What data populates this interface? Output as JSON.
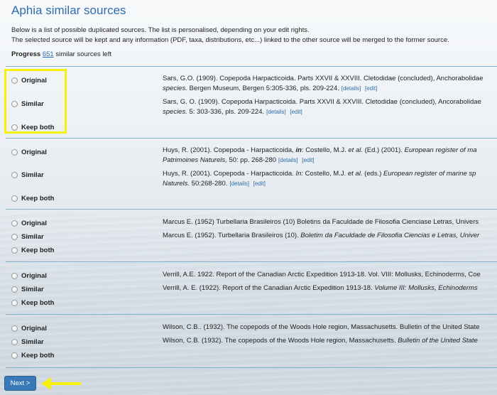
{
  "title": "Aphia similar sources",
  "intro": {
    "line1": "Below is a list of possible duplicated sources. The list is personalised, depending on your edit rights.",
    "line2": "The selected source will be kept and any information (PDF, taxa, distributions, etc...) linked to the other source will be merged to the former source."
  },
  "progress": {
    "label": "Progress",
    "count": "651",
    "suffix": "similar sources left"
  },
  "options": {
    "original": "Original",
    "similar": "Similar",
    "keep_both": "Keep both"
  },
  "links": {
    "details": "[details]",
    "edit": "[edit]"
  },
  "groups": [
    {
      "original": {
        "l1_plain": "Sars, G.O. (1909). Copepoda Harpacticoida. Parts XXVII & XXVIII. Cletodidae (concluded), Anchorabolidae",
        "l2_italic": "species.",
        "l2_plain": " Bergen Museum, Bergen 5:305-336, pls. 209-224."
      },
      "similar": {
        "l1_plain": "Sars, G. O. (1909). Copepoda Harpacticoida. Parts XXVII & XXVIII. Cletodidae (concluded), Ancorabolidae",
        "l2_italic": "species.",
        "l2_plain": " 5: 303-336, pls. 209-224."
      }
    },
    {
      "original": {
        "l1_a": "Huys, R. (2001). Copepoda - Harpacticoida, ",
        "l1_b": "in",
        "l1_c": ": Costello, M.J. ",
        "l1_d": "et al.",
        "l1_e": " (Ed.) (2001). ",
        "l1_f": "European register of ma",
        "l2_italic": "Patrimoines Naturels,",
        "l2_plain": " 50: pp. 268-280"
      },
      "similar": {
        "l1_a": "Huys, R. (2001). Copepoda - Harpacticoida. ",
        "l1_b": "In: ",
        "l1_c": "Costello, M.J. ",
        "l1_d": "et al.",
        "l1_e": " (eds.) ",
        "l1_f": "European register of marine sp",
        "l2_italic": "Naturels.",
        "l2_plain": " 50:268-280."
      }
    },
    {
      "original": {
        "plain": "Marcus E. (1952) Turbellaria Brasileiros (10) Boletins da Faculdade de Filosofia Cienciase Letras, Univers"
      },
      "similar": {
        "plain": "Marcus E. (1952). Turbellaria Brasileiros (10). ",
        "italic": "Boletim da Faculdade de Filosofia Ciencias e Letras, Univer"
      }
    },
    {
      "original": {
        "plain": "Verrill, A.E. 1922. Report of the Canadian Arctic Expedition 1913-18. Vol. VIII: Mollusks, Echinoderms, Coe"
      },
      "similar": {
        "plain": "Verrill, A. E. (1922). Report of the Canadian Arctic Expedition 1913-18. ",
        "italic": "Volume III: Mollusks, Echinoderms"
      }
    },
    {
      "original": {
        "plain": "Wilson, C.B.. (1932). The copepods of the Woods Hole region, Massachusetts. Bulletin of the United State"
      },
      "similar": {
        "plain": "Wilson, C.B. (1932). The copepods of the Woods Hole region, Massachusetts. ",
        "italic": "Bulletin of the United State"
      }
    }
  ],
  "next_button": "Next >",
  "colors": {
    "accent": "#2f6ca8",
    "highlight": "#f6f00f",
    "button": "#3a79b7"
  }
}
